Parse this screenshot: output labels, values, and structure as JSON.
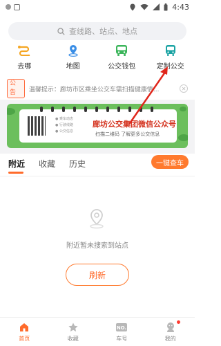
{
  "status_bar": {
    "time": "4:43"
  },
  "search": {
    "placeholder": "查线路、站点、地点"
  },
  "quick_actions": [
    {
      "label": "去哪",
      "icon": "route-icon",
      "color": "#f5a623"
    },
    {
      "label": "地图",
      "icon": "map-pin-icon",
      "color": "#3a8ee6"
    },
    {
      "label": "公交钱包",
      "icon": "bus-wallet-icon",
      "color": "#3bb55a"
    },
    {
      "label": "定制公交",
      "icon": "custom-bus-icon",
      "color": "#1aa3a3"
    }
  ],
  "notice": {
    "tag": "公告",
    "text": "温馨提示：廊坊市区乘坐公交车需扫描健康情..."
  },
  "banner": {
    "title": "廊坊公交集团微信公众号",
    "subtitle": "扫描二维码 了解更多公交信息",
    "bullets": [
      "● 乘车动态",
      "● 行驶线路",
      "● 公交信息"
    ]
  },
  "tabs": [
    {
      "label": "附近",
      "active": true
    },
    {
      "label": "收藏",
      "active": false
    },
    {
      "label": "历史",
      "active": false
    }
  ],
  "one_key_button": "一键查车",
  "empty_state": {
    "message": "附近暂未搜索到站点",
    "refresh_label": "刷新"
  },
  "bottom_nav": [
    {
      "label": "首页",
      "icon": "home-icon",
      "active": true
    },
    {
      "label": "收藏",
      "icon": "star-icon",
      "active": false
    },
    {
      "label": "车号",
      "icon": "bus-number-icon",
      "active": false
    },
    {
      "label": "我的",
      "icon": "profile-icon",
      "active": false
    }
  ],
  "colors": {
    "accent": "#ff6b2b",
    "banner_green": "#6cbf5d",
    "annotation_red": "#e0261b"
  }
}
